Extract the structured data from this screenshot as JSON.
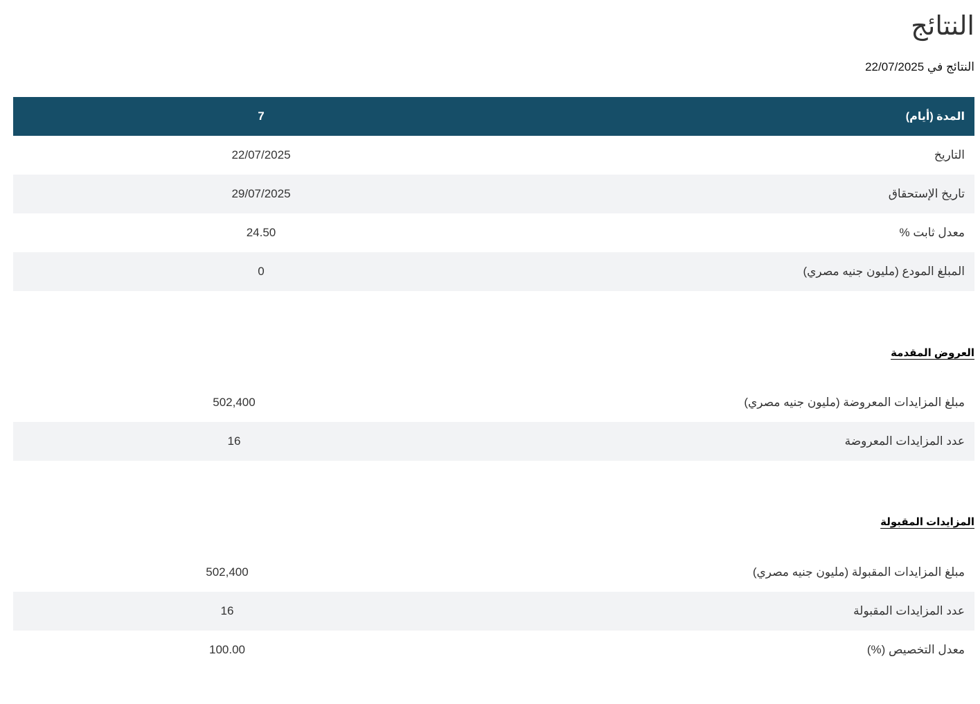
{
  "page": {
    "title": "النتائج",
    "subtitle_prefix": "النتائج في",
    "subtitle_date": "22/07/2025"
  },
  "summary": {
    "header": {
      "label": "المدة (أيام)",
      "value": "7"
    },
    "rows": [
      {
        "label": "التاريخ",
        "value": "22/07/2025"
      },
      {
        "label": "تاريخ الإستحقاق",
        "value": "29/07/2025"
      },
      {
        "label": "معدل ثابت %",
        "value": "24.50"
      },
      {
        "label": "المبلغ المودع (مليون جنيه مصري)",
        "value": "0"
      }
    ]
  },
  "offers": {
    "heading": "العروض المقدمة",
    "rows": [
      {
        "label": "مبلغ المزايدات المعروضة (مليون جنيه مصري)",
        "value": "502,400"
      },
      {
        "label": "عدد المزايدات المعروضة",
        "value": "16"
      }
    ]
  },
  "accepted": {
    "heading": "المزايدات المقبولة",
    "rows": [
      {
        "label": "مبلغ المزايدات المقبولة (مليون جنيه مصري)",
        "value": "502,400"
      },
      {
        "label": "عدد المزايدات المقبولة",
        "value": "16"
      },
      {
        "label": "معدل التخصيص (%)",
        "value": "100.00"
      }
    ]
  },
  "colors": {
    "header_bg": "#164e68",
    "alt_row_bg": "#f2f3f5",
    "text": "#333333"
  }
}
